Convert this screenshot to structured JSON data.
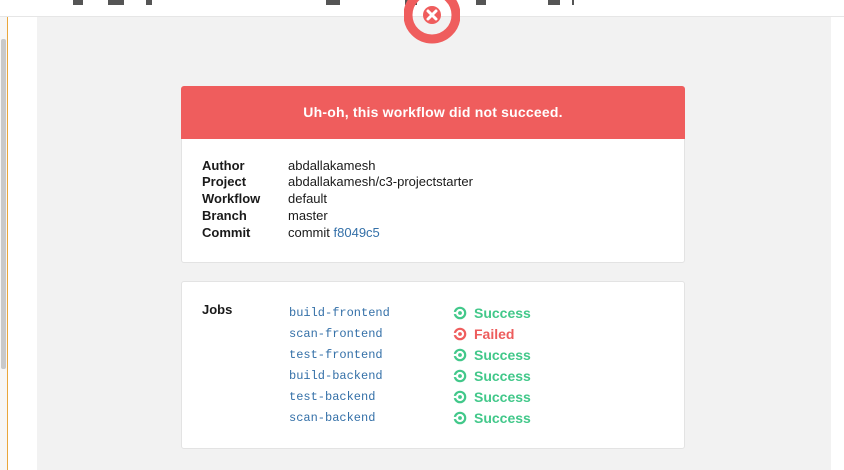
{
  "banner": {
    "title": "Uh-oh, this workflow did not succeed."
  },
  "details": [
    {
      "label": "Author",
      "value": "abdallakamesh",
      "linked": true
    },
    {
      "label": "Project",
      "value": "abdallakamesh/c3-projectstarter",
      "linked": true
    },
    {
      "label": "Workflow",
      "value": "default",
      "linked": true
    },
    {
      "label": "Branch",
      "value": "master",
      "linked": true
    },
    {
      "label": "Commit",
      "prefix": "commit",
      "value": "f8049c5",
      "linked": true
    }
  ],
  "jobs": {
    "label": "Jobs",
    "items": [
      {
        "name": "build-frontend",
        "status": "Success",
        "state": "success"
      },
      {
        "name": "scan-frontend",
        "status": "Failed",
        "state": "failed"
      },
      {
        "name": "test-frontend",
        "status": "Success",
        "state": "success"
      },
      {
        "name": "build-backend",
        "status": "Success",
        "state": "success"
      },
      {
        "name": "test-backend",
        "status": "Success",
        "state": "success"
      },
      {
        "name": "scan-backend",
        "status": "Success",
        "state": "success"
      }
    ]
  },
  "colors": {
    "error": "#ef5d5d",
    "success": "#42c88a",
    "link": "#3470a8",
    "background": "#f2f2f2"
  },
  "icons": {
    "logo": "circleci-logo-icon",
    "success": "check-circle-icon",
    "failed": "failed-circle-icon"
  }
}
